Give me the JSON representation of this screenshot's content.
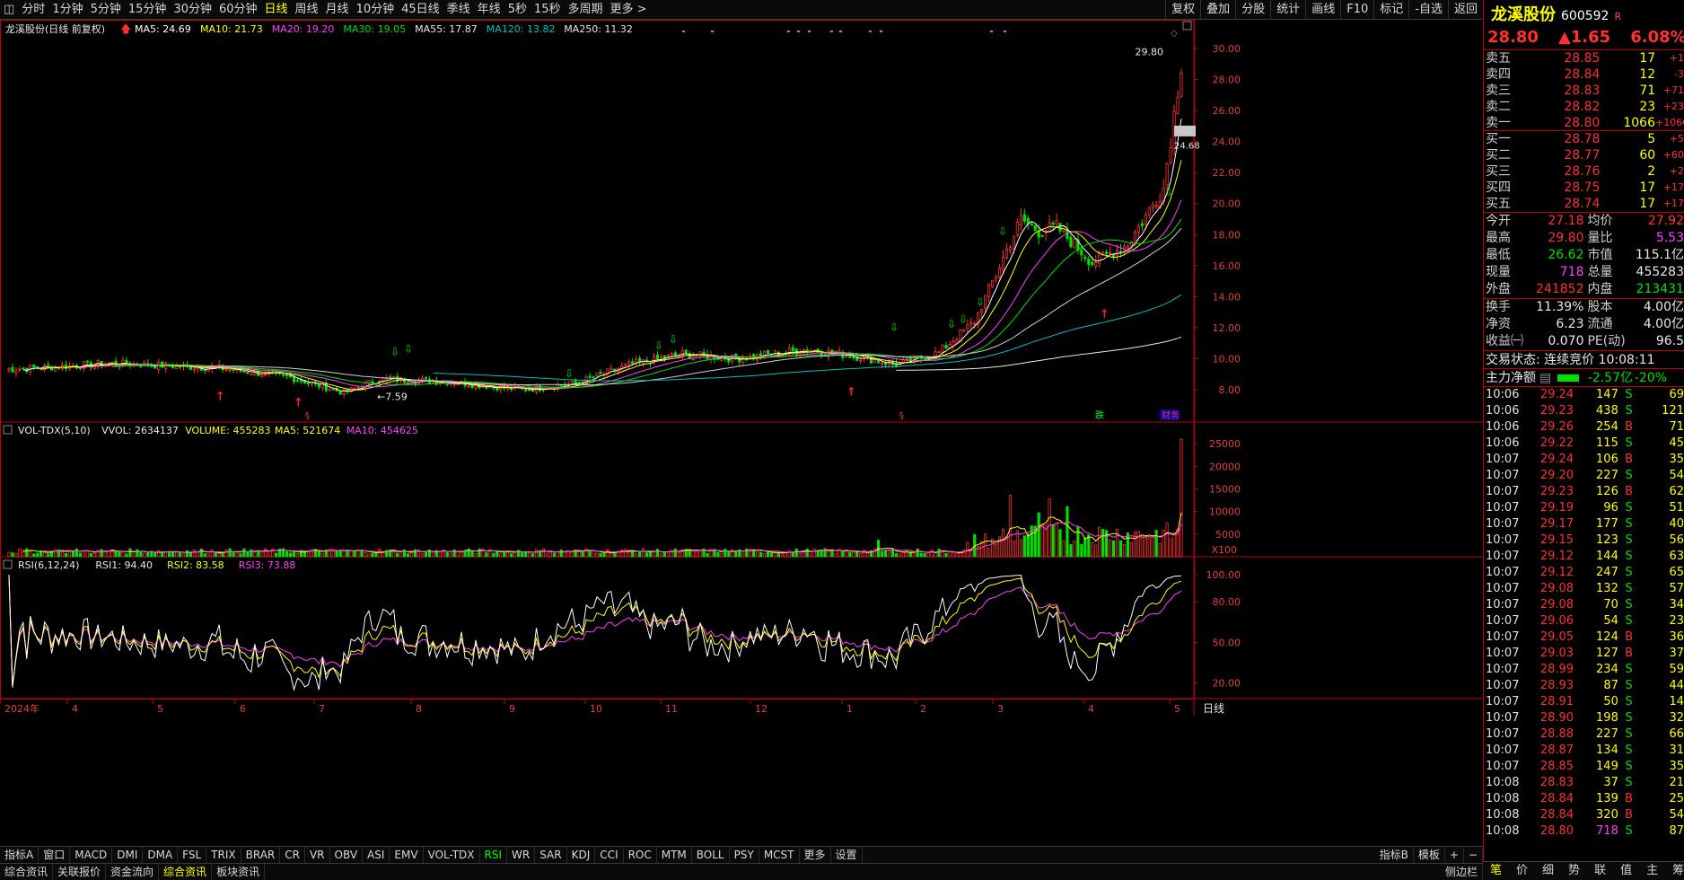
{
  "periods": [
    "分时",
    "1分钟",
    "5分钟",
    "15分钟",
    "30分钟",
    "60分钟",
    "日线",
    "周线",
    "月线",
    "10分钟",
    "45日线",
    "季线",
    "年线",
    "5秒",
    "15秒",
    "多周期",
    "更多 >"
  ],
  "active_period": "日线",
  "toolbar_right": [
    "复权",
    "叠加",
    "分股",
    "统计",
    "画线",
    "F10",
    "标记",
    "-自选",
    "返回"
  ],
  "stock": {
    "name": "龙溪股份",
    "code": "600592",
    "tag": "R",
    "price": "28.80",
    "change": "▲1.65",
    "pct": "6.08%"
  },
  "chart_title": "龙溪股份(日线 前复权)",
  "ma_labels": [
    {
      "t": "MA5: 24.69",
      "c": "#ffffff"
    },
    {
      "t": "MA10: 21.73",
      "c": "#ffff00"
    },
    {
      "t": "MA20: 19.20",
      "c": "#ff40ff"
    },
    {
      "t": "MA30: 19.05",
      "c": "#00e000"
    },
    {
      "t": "MA55: 17.87",
      "c": "#e8e8e8"
    },
    {
      "t": "MA120: 13.82",
      "c": "#00c0c0"
    },
    {
      "t": "MA250: 11.32",
      "c": "#e8e8e8"
    }
  ],
  "vol_labels": [
    {
      "t": "VOL-TDX(5,10)",
      "c": "#e8e8e8"
    },
    {
      "t": "VVOL: 2634137",
      "c": "#e8e8e8"
    },
    {
      "t": "VOLUME: 455283",
      "c": "#ffff00"
    },
    {
      "t": "MA5: 521674",
      "c": "#ffff00"
    },
    {
      "t": "MA10: 454625",
      "c": "#ff40ff"
    }
  ],
  "rsi_labels": [
    {
      "t": "RSI(6,12,24)",
      "c": "#e8e8e8"
    },
    {
      "t": "RSI1: 94.40",
      "c": "#e8e8e8"
    },
    {
      "t": "RSI2: 83.58",
      "c": "#ffff00"
    },
    {
      "t": "RSI3: 73.88",
      "c": "#ff40ff"
    }
  ],
  "price_axis": [
    "30.00",
    "28.00",
    "26.00",
    "24.00",
    "22.00",
    "20.00",
    "18.00",
    "16.00",
    "14.00",
    "12.00",
    "10.00",
    "8.00"
  ],
  "vol_axis": [
    "25000",
    "20000",
    "15000",
    "10000",
    "5000"
  ],
  "vol_unit": "X100",
  "rsi_axis": [
    "100.00",
    "80.00",
    "50.00",
    "20.00"
  ],
  "x_labels": [
    "2024年",
    "4",
    "5",
    "6",
    "7",
    "8",
    "9",
    "10",
    "11",
    "12",
    "1",
    "2",
    "3",
    "4",
    "5"
  ],
  "x_right": "日线",
  "price_marks": {
    "high": "29.80",
    "low": "7.59",
    "right": "24.68"
  },
  "event_marks": [
    "跌",
    "财务"
  ],
  "order_book": [
    {
      "l": "卖五",
      "p": "28.85",
      "v": "17",
      "c": "+1"
    },
    {
      "l": "卖四",
      "p": "28.84",
      "v": "12",
      "c": "-3"
    },
    {
      "l": "卖三",
      "p": "28.83",
      "v": "71",
      "c": "+71"
    },
    {
      "l": "卖二",
      "p": "28.82",
      "v": "23",
      "c": "+23"
    },
    {
      "l": "卖一",
      "p": "28.80",
      "v": "1066",
      "c": "+1066"
    },
    {
      "l": "买一",
      "p": "28.78",
      "v": "5",
      "c": "+5"
    },
    {
      "l": "买二",
      "p": "28.77",
      "v": "60",
      "c": "+60"
    },
    {
      "l": "买三",
      "p": "28.76",
      "v": "2",
      "c": "+2"
    },
    {
      "l": "买四",
      "p": "28.75",
      "v": "17",
      "c": "+17"
    },
    {
      "l": "买五",
      "p": "28.74",
      "v": "17",
      "c": "+17"
    }
  ],
  "stats": [
    {
      "k": "今开",
      "a": "27.18",
      "ac": "r",
      "k2": "均价",
      "b": "27.92",
      "bc": "r"
    },
    {
      "k": "最高",
      "a": "29.80",
      "ac": "r",
      "k2": "量比",
      "b": "5.53",
      "bc": "m"
    },
    {
      "k": "最低",
      "a": "26.62",
      "ac": "g",
      "k2": "市值",
      "b": "115.1亿",
      "bc": "w"
    },
    {
      "k": "现量",
      "a": "718",
      "ac": "m",
      "k2": "总量",
      "b": "455283",
      "bc": "w"
    },
    {
      "k": "外盘",
      "a": "241852",
      "ac": "r",
      "k2": "内盘",
      "b": "213431",
      "bc": "g"
    }
  ],
  "stats2": [
    {
      "k": "换手",
      "a": "11.39%",
      "ac": "w",
      "k2": "股本",
      "b": "4.00亿",
      "bc": "w"
    },
    {
      "k": "净资",
      "a": "6.23",
      "ac": "w",
      "k2": "流通",
      "b": "4.00亿",
      "bc": "w"
    },
    {
      "k": "收益㈠",
      "a": "0.070",
      "ac": "w",
      "k2": "PE(动)",
      "b": "96.5",
      "bc": "w"
    }
  ],
  "trade_status": "交易状态: 连续竞价 10:08:11",
  "main_flow": {
    "label": "主力净额",
    "value": "-2.57亿",
    "pct": "-20%"
  },
  "ticks": [
    [
      "10:06",
      "29.24",
      "147",
      "S",
      "69"
    ],
    [
      "10:06",
      "29.23",
      "438",
      "S",
      "121"
    ],
    [
      "10:06",
      "29.26",
      "254",
      "B",
      "71"
    ],
    [
      "10:06",
      "29.22",
      "115",
      "S",
      "45"
    ],
    [
      "10:07",
      "29.24",
      "106",
      "B",
      "35"
    ],
    [
      "10:07",
      "29.20",
      "227",
      "S",
      "54"
    ],
    [
      "10:07",
      "29.23",
      "126",
      "B",
      "62"
    ],
    [
      "10:07",
      "29.19",
      "96",
      "S",
      "51"
    ],
    [
      "10:07",
      "29.17",
      "177",
      "S",
      "40"
    ],
    [
      "10:07",
      "29.15",
      "123",
      "S",
      "56"
    ],
    [
      "10:07",
      "29.12",
      "144",
      "S",
      "63"
    ],
    [
      "10:07",
      "29.12",
      "247",
      "S",
      "65"
    ],
    [
      "10:07",
      "29.08",
      "132",
      "S",
      "57"
    ],
    [
      "10:07",
      "29.08",
      "70",
      "S",
      "34"
    ],
    [
      "10:07",
      "29.06",
      "54",
      "S",
      "23"
    ],
    [
      "10:07",
      "29.05",
      "124",
      "B",
      "36"
    ],
    [
      "10:07",
      "29.03",
      "127",
      "B",
      "37"
    ],
    [
      "10:07",
      "28.99",
      "234",
      "S",
      "59"
    ],
    [
      "10:07",
      "28.93",
      "87",
      "S",
      "44"
    ],
    [
      "10:07",
      "28.91",
      "50",
      "S",
      "14"
    ],
    [
      "10:07",
      "28.90",
      "198",
      "S",
      "32"
    ],
    [
      "10:07",
      "28.88",
      "227",
      "S",
      "66"
    ],
    [
      "10:07",
      "28.87",
      "134",
      "S",
      "31"
    ],
    [
      "10:07",
      "28.85",
      "149",
      "S",
      "35"
    ],
    [
      "10:08",
      "28.83",
      "37",
      "S",
      "21"
    ],
    [
      "10:08",
      "28.84",
      "139",
      "B",
      "25"
    ],
    [
      "10:08",
      "28.84",
      "320",
      "B",
      "54"
    ],
    [
      "10:08",
      "28.80",
      "718",
      "S",
      "87"
    ]
  ],
  "quote_bottom": [
    "笔",
    "价",
    "细",
    "势",
    "联",
    "值",
    "主",
    "筹"
  ],
  "indicator_tabs": [
    "指标A",
    "窗口",
    "MACD",
    "DMI",
    "DMA",
    "FSL",
    "TRIX",
    "BRAR",
    "CR",
    "VR",
    "OBV",
    "ASI",
    "EMV",
    "VOL-TDX",
    "RSI",
    "WR",
    "SAR",
    "KDJ",
    "CCI",
    "ROC",
    "MTM",
    "BOLL",
    "PSY",
    "MCST",
    "更多",
    "设置"
  ],
  "active_indicator": "RSI",
  "indicator_right": [
    "指标B",
    "模板",
    "+",
    "−"
  ],
  "bottom_tabs": [
    "综合资讯",
    "关联报价",
    "资金流向",
    "综合资讯",
    "板块资讯"
  ],
  "right_tab": "侧边栏"
}
